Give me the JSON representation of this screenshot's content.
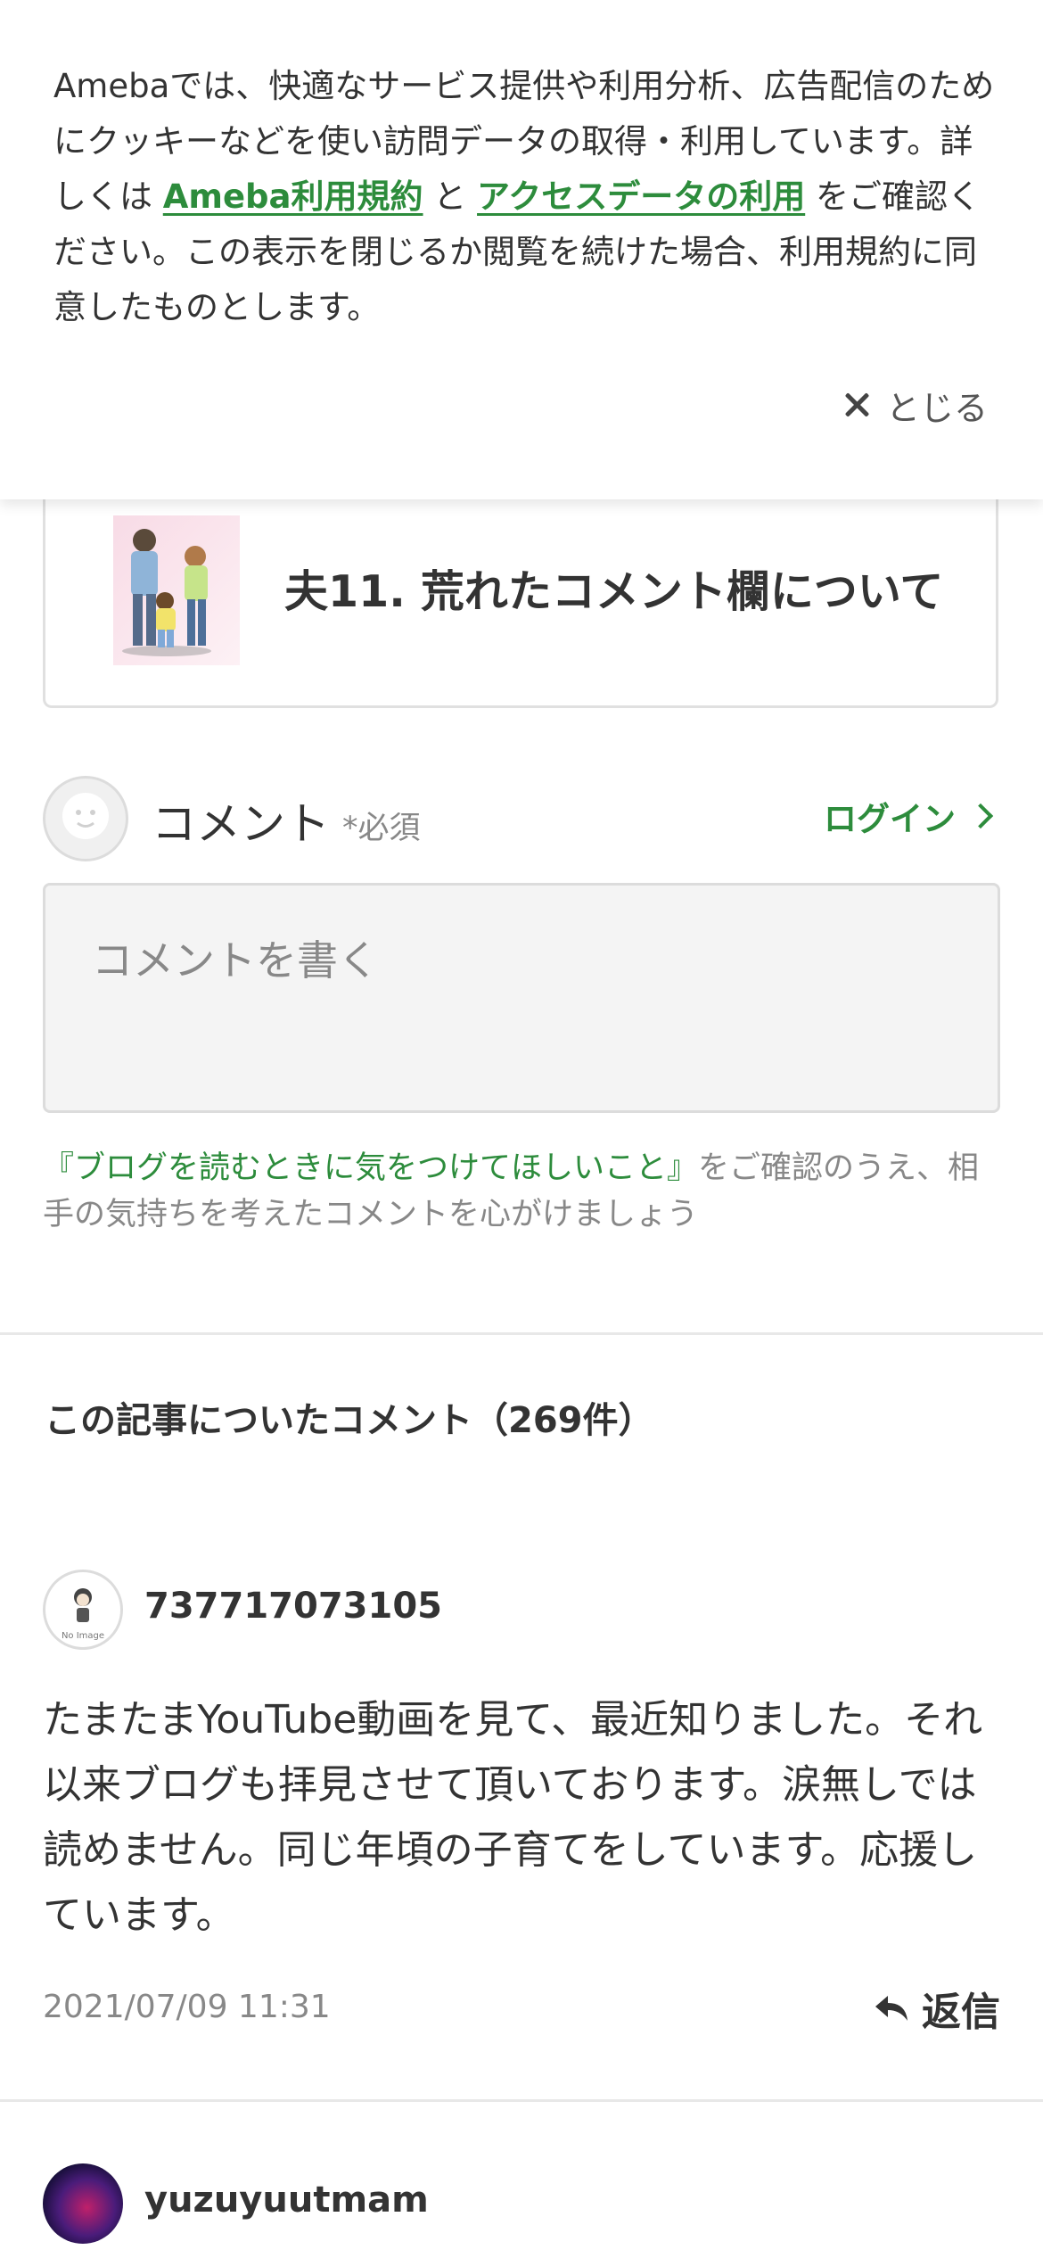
{
  "cookie_banner": {
    "text_1": "Amebaでは、快適なサービス提供や利用分析、広告配信のためにクッキーなどを使い訪問データの取得・利用しています。詳しくは ",
    "link_terms": "Ameba利用規約",
    "text_2": " と ",
    "link_access": "アクセスデータの利用",
    "text_3": " をご確認ください。この表示を閉じるか閲覧を続けた場合、利用規約に同意したものとします。",
    "close_label": "とじる"
  },
  "entry": {
    "title": "夫11. 荒れたコメント欄について"
  },
  "comment_form": {
    "label": "コメント",
    "required": "*必須",
    "login": "ログイン",
    "placeholder": "コメントを書く",
    "guideline_link": "『ブログを読むときに気をつけてほしいこと』",
    "guideline_text": "をご確認のうえ、相手の気持ちを考えたコメントを心がけましょう"
  },
  "comments_section": {
    "title": "この記事についたコメント（269件）",
    "items": [
      {
        "author": "737717073105",
        "avatar_text": "No Image",
        "body": "たまたまYouTube動画を見て、最近知りました。それ以来ブログも拝見させて頂いております。涙無しでは読めません。同じ年頃の子育てをしています。応援しています。",
        "date": "2021/07/09 11:31",
        "reply_label": "返信"
      },
      {
        "author": "yuzuyuutmam"
      }
    ]
  },
  "colors": {
    "accent_green": "#2d8c3c",
    "text": "#333333",
    "muted": "#888888"
  }
}
